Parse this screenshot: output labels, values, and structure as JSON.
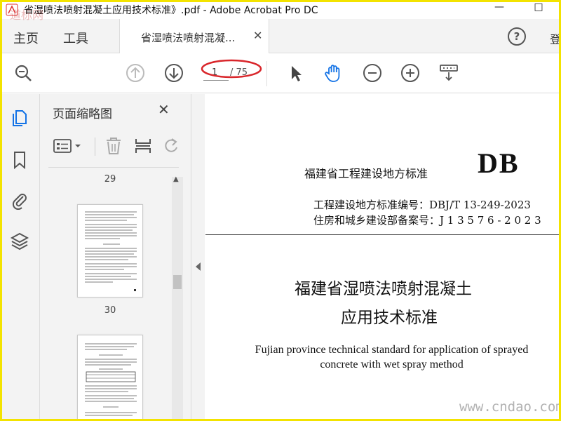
{
  "window": {
    "title": "省湿喷法喷射混凝土应用技术标准》.pdf - Adobe Acrobat Pro DC",
    "minimize": "—",
    "maximize": "□"
  },
  "tabs": {
    "home": "主页",
    "tools": "工具",
    "document_tab": "省湿喷法喷射混凝...",
    "close": "✕",
    "help": "?",
    "signin_partial": "登"
  },
  "toolbar": {
    "page_current": "1",
    "page_total": "/ 75"
  },
  "panel": {
    "title": "页面缩略图",
    "close": "✕",
    "thumbnails": [
      {
        "label": "29"
      },
      {
        "label": "30"
      }
    ]
  },
  "document": {
    "logo": "DB",
    "header": "福建省工程建设地方标准",
    "standard_code": "工程建设地方标准编号：DBJ/T 13-249-2023",
    "record_number": "住房和城乡建设部备案号：J 1 3 5 7 6 - 2 0 2 3",
    "title_line1": "福建省湿喷法喷射混凝土",
    "title_line2": "应用技术标准",
    "english_line1": "Fujian province technical standard for application of sprayed",
    "english_line2": "concrete with wet spray method"
  },
  "watermarks": {
    "top_left": "道标网",
    "bottom_right": "www.cndao.com"
  },
  "colors": {
    "frame": "#f3e300",
    "accent_blue": "#1473e6",
    "annotation_red": "#d9262b"
  }
}
